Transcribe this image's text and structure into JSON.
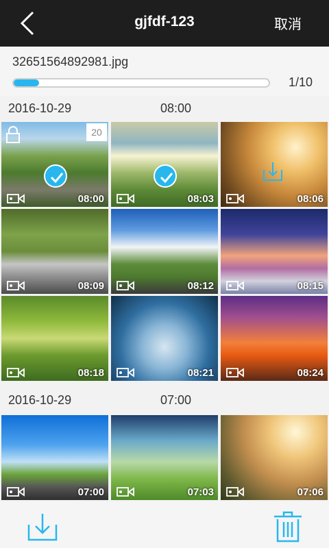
{
  "header": {
    "title": "gjfdf-123",
    "cancel_label": "取消"
  },
  "progress": {
    "filename": "32651564892981.jpg",
    "count": "1/10",
    "fraction": 0.1
  },
  "colors": {
    "accent": "#27b7ee",
    "topbar": "#1e1e1e"
  },
  "groups": [
    {
      "date": "2016-10-29",
      "time": "08:00",
      "tiles": [
        {
          "time": "08:00",
          "badge": "20",
          "locked": true,
          "checked": true,
          "photo": "p1"
        },
        {
          "time": "08:03",
          "checked": true,
          "photo": "p2"
        },
        {
          "time": "08:06",
          "downloading": true,
          "photo": "p3"
        },
        {
          "time": "08:09",
          "photo": "p4"
        },
        {
          "time": "08:12",
          "photo": "p5"
        },
        {
          "time": "08:15",
          "photo": "p6"
        },
        {
          "time": "08:18",
          "photo": "p7"
        },
        {
          "time": "08:21",
          "photo": "p8"
        },
        {
          "time": "08:24",
          "photo": "p9"
        }
      ]
    },
    {
      "date": "2016-10-29",
      "time": "07:00",
      "tiles": [
        {
          "time": "07:00",
          "photo": "p10"
        },
        {
          "time": "07:03",
          "photo": "p11"
        },
        {
          "time": "07:06",
          "photo": "p12"
        }
      ]
    }
  ],
  "icons": {
    "back": "chevron-left-icon",
    "video": "video-camera-icon",
    "check": "check-circle-icon",
    "lock": "lock-icon",
    "download": "download-icon",
    "delete": "trash-icon"
  }
}
